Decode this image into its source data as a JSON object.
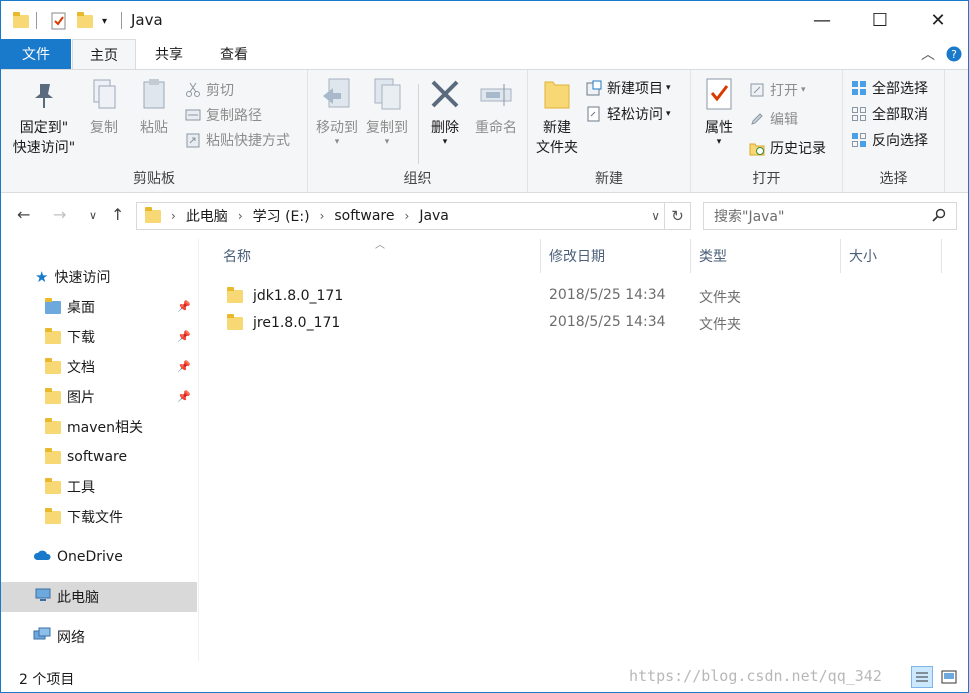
{
  "window": {
    "title": "Java"
  },
  "window_controls": {
    "minimize": "—",
    "maximize": "☐",
    "close": "✕"
  },
  "tabs": {
    "file": "文件",
    "home": "主页",
    "share": "共享",
    "view": "查看"
  },
  "ribbon": {
    "clipboard": {
      "label": "剪贴板",
      "pin_quick_access_line1": "固定到\"",
      "pin_quick_access_line2": "快速访问\"",
      "copy": "复制",
      "paste": "粘贴",
      "cut": "剪切",
      "copy_path": "复制路径",
      "paste_shortcut": "粘贴快捷方式"
    },
    "organize": {
      "label": "组织",
      "move_to": "移动到",
      "copy_to": "复制到",
      "delete": "删除",
      "rename": "重命名"
    },
    "new": {
      "label": "新建",
      "new_folder_line1": "新建",
      "new_folder_line2": "文件夹",
      "new_item": "新建项目",
      "easy_access": "轻松访问"
    },
    "open": {
      "label": "打开",
      "properties": "属性",
      "open": "打开",
      "edit": "编辑",
      "history": "历史记录"
    },
    "select": {
      "label": "选择",
      "select_all": "全部选择",
      "select_none": "全部取消",
      "invert": "反向选择"
    }
  },
  "address": {
    "crumbs": [
      "此电脑",
      "学习 (E:)",
      "software",
      "Java"
    ],
    "search_placeholder": "搜索\"Java\""
  },
  "nav": {
    "quick_access": "快速访问",
    "items": [
      "桌面",
      "下载",
      "文档",
      "图片",
      "maven相关",
      "software",
      "工具",
      "下载文件"
    ],
    "onedrive": "OneDrive",
    "this_pc": "此电脑",
    "network": "网络"
  },
  "columns": {
    "name": "名称",
    "modified": "修改日期",
    "type": "类型",
    "size": "大小"
  },
  "files": [
    {
      "name": "jdk1.8.0_171",
      "modified": "2018/5/25 14:34",
      "type": "文件夹"
    },
    {
      "name": "jre1.8.0_171",
      "modified": "2018/5/25 14:34",
      "type": "文件夹"
    }
  ],
  "status": {
    "count": "2 个项目"
  },
  "watermark": "https://blog.csdn.net/qq_342"
}
